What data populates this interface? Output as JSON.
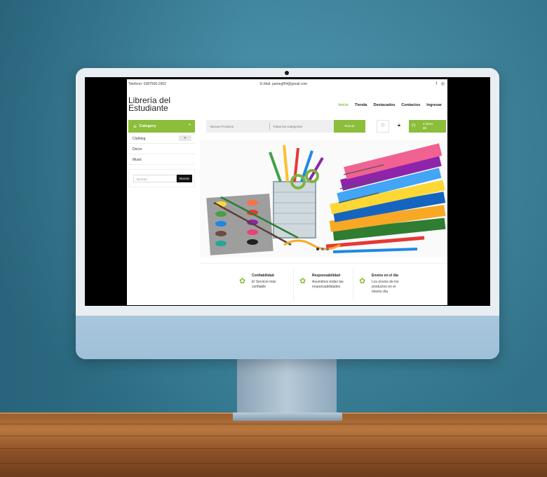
{
  "topbar": {
    "phone": "Telefono: 0387566-2902",
    "email": "E-Mail: pamegf94@gmail.com",
    "social_icons": [
      "facebook-icon",
      "instagram-icon"
    ]
  },
  "brand": {
    "line1": "Librería del",
    "line2": "Estudiante"
  },
  "nav": {
    "items": [
      "Inicio",
      "Tienda",
      "Destacados",
      "Contactos",
      "Ingresar"
    ],
    "active": "Inicio"
  },
  "category": {
    "button_label": "Category",
    "items": [
      {
        "label": "Clothing",
        "has_toggle": true,
        "toggle": "+"
      },
      {
        "label": "Decor",
        "has_toggle": false
      },
      {
        "label": "Music",
        "has_toggle": false
      }
    ]
  },
  "side_search": {
    "placeholder": "Buscar...",
    "button": "Buscar"
  },
  "product_search": {
    "placeholder": "Buscar Producto",
    "categories": "Todas las Categorias",
    "button": "Buscar"
  },
  "cart": {
    "line1": "0 items",
    "line2": "$0"
  },
  "features": [
    {
      "title": "Confiabilidad",
      "desc": "El Servicio más confiable"
    },
    {
      "title": "Responsabilidad",
      "desc": "Asumimos todas las responsabilidades"
    },
    {
      "title": "Envios en el día",
      "desc": "Los envios de los productos en el mismo día"
    }
  ],
  "colors": {
    "accent": "#8cbd3b",
    "wall": "#3b8ba6",
    "desk": "#9a5e2e"
  }
}
